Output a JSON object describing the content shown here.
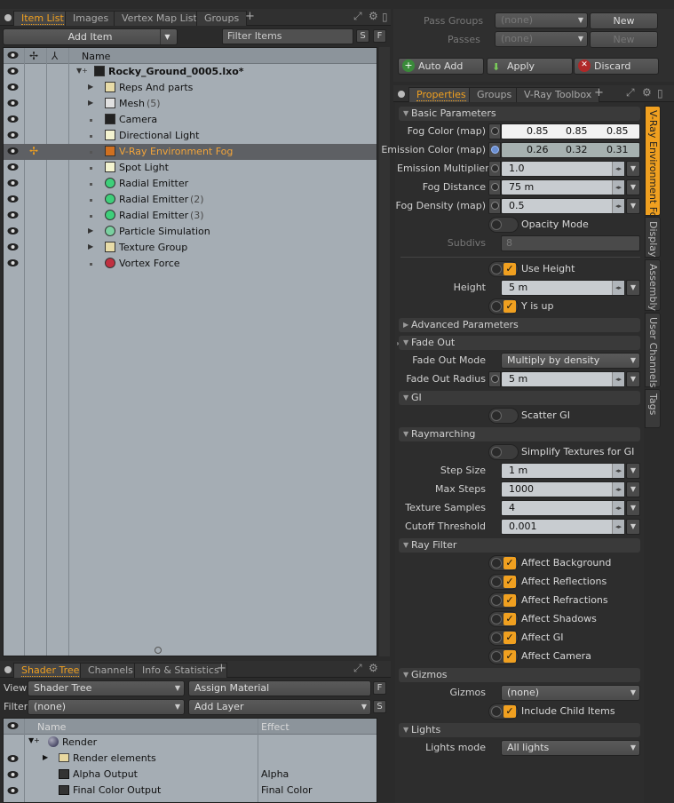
{
  "item_panel": {
    "tabs": [
      {
        "label": "Item List",
        "active": true
      },
      {
        "label": "Images",
        "active": false
      },
      {
        "label": "Vertex Map List",
        "active": false
      },
      {
        "label": "Groups",
        "active": false
      }
    ],
    "plus": "+",
    "add_item": "Add Item",
    "filter_items": "Filter Items",
    "s_btn": "S",
    "f_btn": "F",
    "col_name": "Name",
    "items": [
      {
        "label": "Rocky_Ground_0005.lxo*",
        "count": "",
        "icon": "scene-icon",
        "bold": true,
        "selected": false
      },
      {
        "label": "Reps And parts",
        "count": "",
        "icon": "group-folder-icon",
        "bold": false,
        "selected": false
      },
      {
        "label": "Mesh",
        "count": "(5)",
        "icon": "mesh-icon",
        "bold": false,
        "selected": false
      },
      {
        "label": "Camera",
        "count": "",
        "icon": "camera-icon",
        "bold": false,
        "selected": false
      },
      {
        "label": "Directional Light",
        "count": "",
        "icon": "directional-light-icon",
        "bold": false,
        "selected": false
      },
      {
        "label": "V-Ray Environment Fog",
        "count": "",
        "icon": "vray-fog-icon",
        "bold": false,
        "selected": true
      },
      {
        "label": "Spot Light",
        "count": "",
        "icon": "spot-light-icon",
        "bold": false,
        "selected": false
      },
      {
        "label": "Radial Emitter",
        "count": "",
        "icon": "radial-emitter-icon",
        "bold": false,
        "selected": false
      },
      {
        "label": "Radial Emitter",
        "count": "(2)",
        "icon": "radial-emitter-icon",
        "bold": false,
        "selected": false
      },
      {
        "label": "Radial Emitter",
        "count": "(3)",
        "icon": "radial-emitter-icon",
        "bold": false,
        "selected": false
      },
      {
        "label": "Particle Simulation",
        "count": "",
        "icon": "particle-sim-icon",
        "bold": false,
        "selected": false
      },
      {
        "label": "Texture Group",
        "count": "",
        "icon": "group-folder-icon",
        "bold": false,
        "selected": false
      },
      {
        "label": "Vortex Force",
        "count": "",
        "icon": "vortex-force-icon",
        "bold": false,
        "selected": false
      }
    ]
  },
  "shader_panel": {
    "tabs": [
      {
        "label": "Shader Tree",
        "active": true
      },
      {
        "label": "Channels",
        "active": false
      },
      {
        "label": "Info & Statistics",
        "active": false
      }
    ],
    "plus": "+",
    "view_label": "View",
    "view_value": "Shader Tree",
    "assign_material": "Assign Material",
    "f_btn": "F",
    "filter_label": "Filter",
    "filter_value": "(none)",
    "add_layer": "Add Layer",
    "s_btn": "S",
    "col_name": "Name",
    "col_effect": "Effect",
    "rows": [
      {
        "name": "Render",
        "effect": ""
      },
      {
        "name": "Render elements",
        "effect": ""
      },
      {
        "name": "Alpha Output",
        "effect": "Alpha"
      },
      {
        "name": "Final Color Output",
        "effect": "Final Color"
      }
    ]
  },
  "top_right": {
    "pass_groups_label": "Pass Groups",
    "pass_groups_value": "(none)",
    "new1": "New",
    "passes_label": "Passes",
    "passes_value": "(none)",
    "new2": "New",
    "auto_add": "Auto Add",
    "apply": "Apply",
    "discard": "Discard"
  },
  "props_panel": {
    "tabs": [
      {
        "label": "Properties",
        "active": true
      },
      {
        "label": "Groups",
        "active": false
      },
      {
        "label": "V-Ray Toolbox",
        "active": false
      }
    ],
    "plus": "+",
    "side_tabs": [
      "V-Ray Environment Fog",
      "Display",
      "Assembly",
      "User Channels",
      "Tags"
    ],
    "sections": {
      "basic": "Basic Parameters",
      "advanced": "Advanced Parameters",
      "fade_out": "Fade Out",
      "gi": "GI",
      "raymarching": "Raymarching",
      "ray_filter": "Ray Filter",
      "gizmos": "Gizmos",
      "lights": "Lights"
    },
    "fog_color_label": "Fog Color (map)",
    "fog_color": [
      "0.85",
      "0.85",
      "0.85"
    ],
    "emission_color_label": "Emission Color (map)",
    "emission_color": [
      "0.26",
      "0.32",
      "0.31"
    ],
    "emission_mult_label": "Emission Multiplier ...",
    "emission_mult": "1.0",
    "fog_distance_label": "Fog Distance",
    "fog_distance": "75 m",
    "fog_density_label": "Fog Density (map)",
    "fog_density": "0.5",
    "opacity_mode": "Opacity Mode",
    "subdivs_label": "Subdivs",
    "subdivs": "8",
    "use_height": "Use Height",
    "height_label": "Height",
    "height": "5 m",
    "y_is_up": "Y is up",
    "fade_out_mode_label": "Fade Out Mode",
    "fade_out_mode": "Multiply by density",
    "fade_out_radius_label": "Fade Out Radius",
    "fade_out_radius": "5 m",
    "scatter_gi": "Scatter GI",
    "simplify_textures": "Simplify Textures for GI",
    "step_size_label": "Step Size",
    "step_size": "1 m",
    "max_steps_label": "Max Steps",
    "max_steps": "1000",
    "texture_samples_label": "Texture Samples",
    "texture_samples": "4",
    "cutoff_label": "Cutoff Threshold",
    "cutoff": "0.001",
    "affect_background": "Affect Background",
    "affect_reflections": "Affect Reflections",
    "affect_refractions": "Affect Refractions",
    "affect_shadows": "Affect Shadows",
    "affect_gi": "Affect GI",
    "affect_camera": "Affect Camera",
    "gizmos_label": "Gizmos",
    "gizmos": "(none)",
    "include_child": "Include Child Items",
    "lights_mode_label": "Lights mode",
    "lights_mode": "All lights",
    "accent": "#f0a020"
  }
}
